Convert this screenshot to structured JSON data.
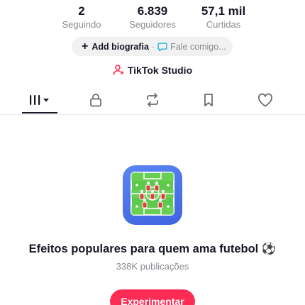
{
  "stats": [
    {
      "value": "2",
      "label": "Seguindo"
    },
    {
      "value": "6.839",
      "label": "Seguidores"
    },
    {
      "value": "57,1 mil",
      "label": "Curtidas"
    }
  ],
  "bio": {
    "add_label": "Add biografia",
    "separator": "·",
    "chat_label": "Fale comigo..."
  },
  "studio": {
    "label": "TikTok Studio"
  },
  "tabs": [
    {
      "icon": "grid-icon",
      "active": true
    },
    {
      "icon": "lock-icon",
      "active": false
    },
    {
      "icon": "repost-icon",
      "active": false
    },
    {
      "icon": "bookmark-icon",
      "active": false
    },
    {
      "icon": "heart-icon",
      "active": false
    }
  ],
  "empty_state": {
    "icon": "football-field-icon",
    "title": "Efeitos populares para quem ama futebol ⚽",
    "subtitle": "338K publicações",
    "button_label": "Experimentar"
  },
  "colors": {
    "accent": "#fe2c55",
    "text": "#161823",
    "muted": "#8a8b91",
    "icon_bg": "#4a72ea",
    "field_green": "#5cc94a"
  }
}
